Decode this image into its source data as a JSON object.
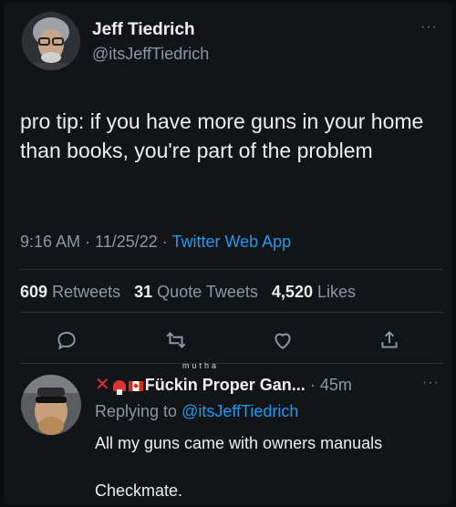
{
  "tweet": {
    "author_name": "Jeff Tiedrich",
    "author_handle": "@itsJeffTiedrich",
    "more": "···",
    "text": "pro tip: if you have more guns in your home than books, you're part of the problem",
    "time": "9:16 AM",
    "date": "11/25/22",
    "sep": " · ",
    "source": "Twitter Web App",
    "stats": {
      "retweets_count": "609",
      "retweets_label": "Retweets",
      "quotes_count": "31",
      "quotes_label": "Quote Tweets",
      "likes_count": "4,520",
      "likes_label": "Likes"
    },
    "actions": [
      "reply-icon",
      "retweet-icon",
      "like-icon",
      "share-icon"
    ]
  },
  "reply": {
    "prefix_x": "✕",
    "small_text": "mutha",
    "author_name": "Fückin Proper Gan...",
    "time": "45m",
    "more": "···",
    "replying_label": "Replying to",
    "replying_mention": "@itsJeffTiedrich",
    "text": "All my guns came with owners manuals\n\nCheckmate."
  },
  "colors": {
    "background": "#121418",
    "accent": "#1d9bf0",
    "muted": "#8b98a5",
    "text": "#e7e9ea"
  }
}
